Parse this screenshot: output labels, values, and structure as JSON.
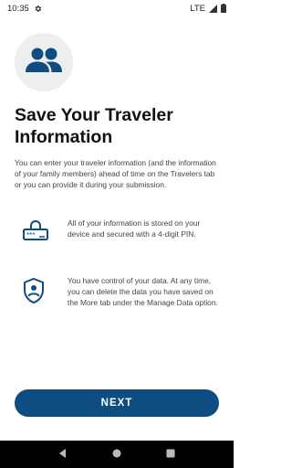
{
  "status_bar": {
    "time": "10:35",
    "network": "LTE",
    "icons": [
      "settings-icon",
      "wifi-icon",
      "lte-signal-icon",
      "battery-icon"
    ]
  },
  "hero": {
    "icon": "people-icon"
  },
  "title": "Save Your Traveler Information",
  "intro": "You can enter your traveler information (and the information of your family members) ahead of time on the Travelers tab or you can provide it during your submission.",
  "features": [
    {
      "icon": "pin-lock-icon",
      "text": "All of your information is stored on your device and secured with a 4-digit PIN."
    },
    {
      "icon": "shield-user-icon",
      "text": "You have control of your data. At any time, you can delete the data you have saved on the More tab under the Manage Data option."
    }
  ],
  "next_button": {
    "label": "NEXT"
  },
  "nav_bar": {
    "items": [
      "back-icon",
      "home-icon",
      "recents-icon"
    ]
  },
  "colors": {
    "primary": "#0f4c81",
    "hero_bg": "#eeeeee",
    "nav_bg": "#000000"
  }
}
